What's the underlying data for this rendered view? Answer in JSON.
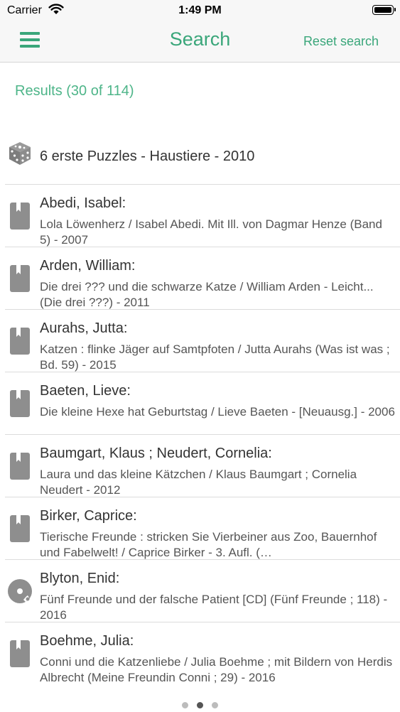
{
  "status": {
    "carrier": "Carrier",
    "time": "1:49 PM"
  },
  "nav": {
    "title": "Search",
    "reset_label": "Reset search"
  },
  "results": {
    "summary": "Results (30 of 114)"
  },
  "items": [
    {
      "type": "game",
      "icon": "dice-icon",
      "title": "6 erste Puzzles - Haustiere - 2010",
      "sub": ""
    },
    {
      "type": "book",
      "icon": "book-icon",
      "title": "Abedi, Isabel:",
      "sub": "Lola Löwenherz / Isabel Abedi. Mit Ill. von Dagmar Henze (Band 5) - 2007"
    },
    {
      "type": "book",
      "icon": "book-icon",
      "title": "Arden, William:",
      "sub": "Die drei ??? und die schwarze Katze / William Arden - Leicht... (Die drei ???) - 2011"
    },
    {
      "type": "book",
      "icon": "book-icon",
      "title": "Aurahs, Jutta:",
      "sub": "Katzen : flinke Jäger auf Samtpfoten / Jutta Aurahs (Was ist was ; Bd. 59) - 2015"
    },
    {
      "type": "book",
      "icon": "book-icon",
      "title": "Baeten, Lieve:",
      "sub": "Die kleine Hexe hat Geburtstag / Lieve Baeten - [Neuausg.] - 2006"
    },
    {
      "type": "book",
      "icon": "book-icon",
      "title": "Baumgart, Klaus ; Neudert, Cornelia:",
      "sub": "Laura und das kleine Kätzchen / Klaus Baumgart ; Cornelia Neudert - 2012"
    },
    {
      "type": "book",
      "icon": "book-icon",
      "title": "Birker, Caprice:",
      "sub": "Tierische Freunde : stricken Sie Vierbeiner aus Zoo, Bauernhof und Fabelwelt! / Caprice Birker - 3. Aufl. (…"
    },
    {
      "type": "cd",
      "icon": "cd-icon",
      "title": "Blyton, Enid:",
      "sub": "Fünf Freunde und der falsche Patient [CD] (Fünf Freunde ; 118) - 2016"
    },
    {
      "type": "book",
      "icon": "book-icon",
      "title": "Boehme, Julia:",
      "sub": "Conni und die Katzenliebe / Julia Boehme ; mit Bildern von Herdis Albrecht (Meine Freundin Conni ; 29) - 2016"
    }
  ],
  "pager": {
    "pages": 3,
    "active": 1
  },
  "colors": {
    "accent": "#3aa67a",
    "icon_gray": "#8e8e8e"
  }
}
